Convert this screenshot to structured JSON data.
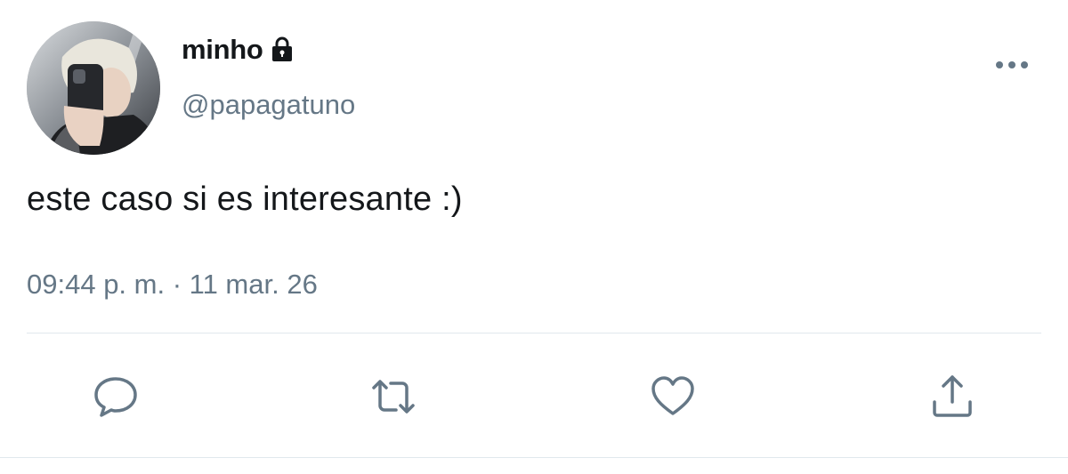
{
  "user": {
    "display_name": "minho",
    "handle": "@papagatuno",
    "protected": true,
    "avatar_icon": "profile-photo"
  },
  "tweet": {
    "text": "este caso si es interesante :)",
    "timestamp": "09:44 p. m. · 11 mar. 26"
  },
  "actions": [
    {
      "name": "reply",
      "icon": "speech-bubble-icon"
    },
    {
      "name": "retweet",
      "icon": "retweet-arrows-icon"
    },
    {
      "name": "like",
      "icon": "heart-icon"
    },
    {
      "name": "share",
      "icon": "share-upload-icon"
    }
  ],
  "colors": {
    "primary_text": "#14171a",
    "secondary_text": "#657786",
    "divider": "#e1e8ed"
  }
}
